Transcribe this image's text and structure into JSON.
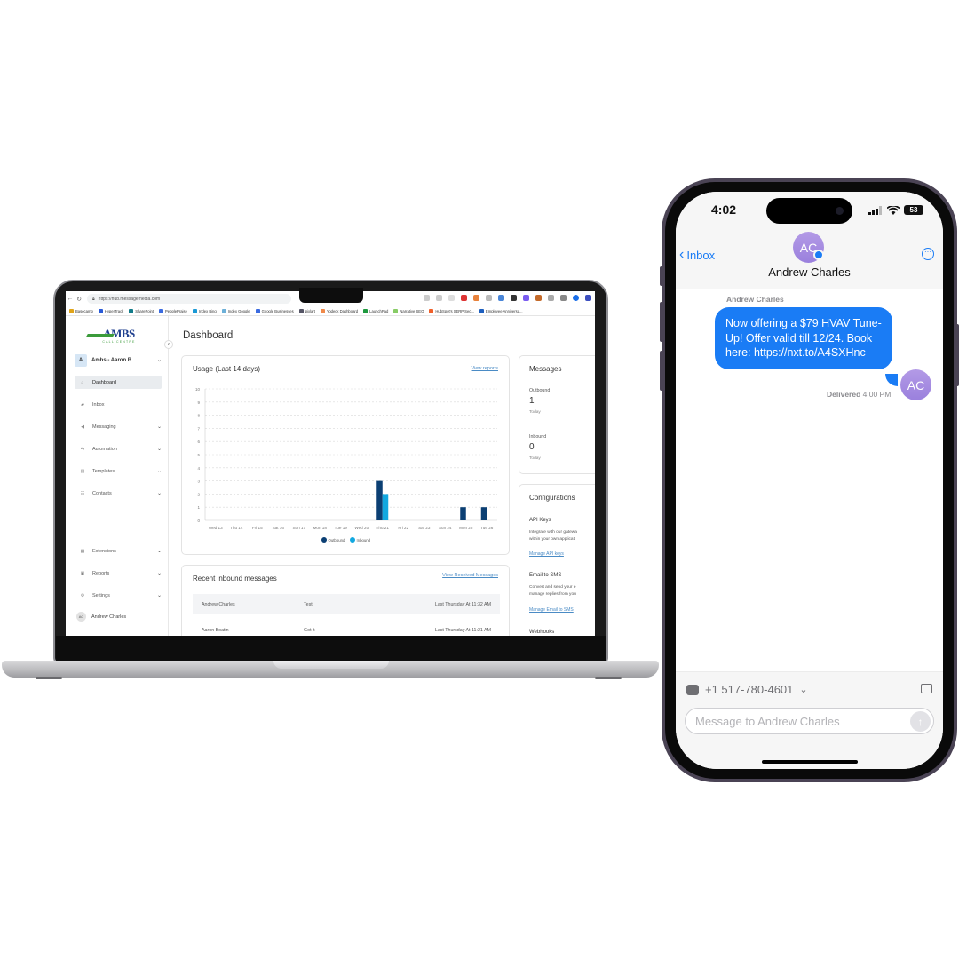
{
  "laptop": {
    "browser": {
      "url": "https://hub.messagemedia.com",
      "bookmarks": [
        "Basecamp",
        "HyperTrack",
        "SharePoint",
        "PeoplePraise",
        "Index Bing",
        "Index Google",
        "Google Businesses",
        "pixlart",
        "Yodeck Dashboard",
        "LaunchPad",
        "Narrative SEO",
        "HubSpot's SERP Sec...",
        "Employee Anniversa..."
      ]
    },
    "sidebar": {
      "logo_main": "AMBS",
      "logo_sub": "CALL CENTRE",
      "account_initial": "A",
      "account_name": "Ambs - Aaron B...",
      "items": [
        {
          "label": "Dashboard",
          "icon": "home-icon",
          "active": true
        },
        {
          "label": "Inbox",
          "icon": "chat-icon"
        },
        {
          "label": "Messaging",
          "icon": "megaphone-icon"
        },
        {
          "label": "Automation",
          "icon": "automation-icon"
        },
        {
          "label": "Templates",
          "icon": "templates-icon"
        },
        {
          "label": "Contacts",
          "icon": "contacts-icon"
        },
        {
          "label": "Extensions",
          "icon": "grid-icon"
        },
        {
          "label": "Reports",
          "icon": "reports-icon"
        },
        {
          "label": "Settings",
          "icon": "gear-icon"
        }
      ],
      "user_initials": "AC",
      "user_name": "Andrew Charles"
    },
    "page_title": "Dashboard",
    "usage": {
      "title": "Usage (Last 14 days)",
      "link": "View reports"
    },
    "messages": {
      "title": "Messages",
      "outbound_label": "Outbound",
      "outbound_value": "1",
      "outbound_sub": "Today",
      "inbound_label": "Inbound",
      "inbound_value": "0",
      "inbound_sub": "Today"
    },
    "configurations": {
      "title": "Configurations",
      "api_title": "API Keys",
      "api_desc_1": "Integrate with our gatewa",
      "api_desc_2": "within your own applicat",
      "api_link": "Manage API keys",
      "email_title": "Email to SMS",
      "email_desc_1": "Convert and send your e",
      "email_desc_2": "manage replies from you",
      "email_link": "Manage Email to SMS",
      "webhooks_title": "Webhooks"
    },
    "recent": {
      "title": "Recent inbound messages",
      "link": "View Received Messages",
      "rows": [
        {
          "name": "Andrew Charles",
          "message": "Test!",
          "time": "Last Thursday At 11:32 AM"
        },
        {
          "name": "Aaron Boatin",
          "message": "Got it",
          "time": "Last Thursday At 11:21 AM"
        }
      ]
    }
  },
  "chart_data": {
    "type": "bar",
    "title": "Usage (Last 14 days)",
    "xlabel": "",
    "ylabel": "",
    "categories": [
      "Wed 13",
      "Thu 14",
      "Fri 15",
      "Sat 16",
      "Sun 17",
      "Mon 18",
      "Tue 19",
      "Wed 20",
      "Thu 21",
      "Fri 22",
      "Sat 23",
      "Sun 24",
      "Mon 25",
      "Tue 26"
    ],
    "series": [
      {
        "name": "Outbound",
        "color": "#0b3f73",
        "values": [
          0,
          0,
          0,
          0,
          0,
          0,
          0,
          0,
          3,
          0,
          0,
          0,
          1,
          1
        ]
      },
      {
        "name": "Inbound",
        "color": "#12a8e0",
        "values": [
          0,
          0,
          0,
          0,
          0,
          0,
          0,
          0,
          2,
          0,
          0,
          0,
          0,
          0
        ]
      }
    ],
    "ylim": [
      0,
      10
    ],
    "yticks": [
      0,
      1,
      2,
      3,
      4,
      5,
      6,
      7,
      8,
      9,
      10
    ],
    "grid": true,
    "legend": "bottom-center"
  },
  "phone": {
    "status_time": "4:02",
    "battery": "53",
    "back_label": "Inbox",
    "contact_initials": "AC",
    "contact_name": "Andrew Charles",
    "sender_label": "Andrew Charles",
    "message_text": "Now offering a $79 HVAV Tune-Up! Offer valid till 12/24. Book here: https://nxt.to/A4SXHnc",
    "delivered_label": "Delivered",
    "delivered_time": "4:00 PM",
    "my_initials": "AC",
    "from_number": "+1 517-780-4601",
    "input_placeholder": "Message to Andrew Charles",
    "accent": "#1a7cf5"
  }
}
